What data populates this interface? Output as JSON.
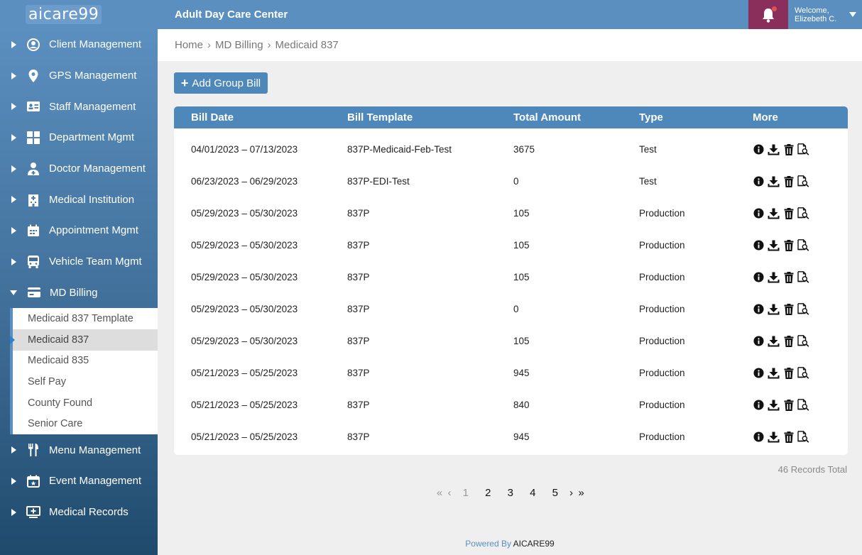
{
  "header": {
    "logo_text": "aicare99",
    "title": "Adult Day Care Center",
    "welcome": "Welcome,",
    "user_name": "Elizebeth C."
  },
  "sidebar": {
    "items": [
      {
        "label": "Client Management",
        "icon": "user-circle-icon"
      },
      {
        "label": "GPS Management",
        "icon": "location-pin-icon"
      },
      {
        "label": "Staff Management",
        "icon": "id-card-icon"
      },
      {
        "label": "Department Mgmt",
        "icon": "grid-icon"
      },
      {
        "label": "Doctor Management",
        "icon": "doctor-icon"
      },
      {
        "label": "Medical Institution",
        "icon": "hospital-icon"
      },
      {
        "label": "Appointment Mgmt",
        "icon": "calendar-icon"
      },
      {
        "label": "Vehicle Team Mgmt",
        "icon": "bus-icon"
      },
      {
        "label": "MD Billing",
        "icon": "credit-card-icon"
      },
      {
        "label": "Menu Management",
        "icon": "fork-knife-icon"
      },
      {
        "label": "Event Management",
        "icon": "calendar-star-icon"
      },
      {
        "label": "Medical Records",
        "icon": "medical-monitor-icon"
      }
    ],
    "submenu": [
      "Medicaid 837 Template",
      "Medicaid 837",
      "Medicaid 835",
      "Self Pay",
      "County Found",
      "Senior Care"
    ]
  },
  "breadcrumb": [
    "Home",
    "MD Billing",
    "Medicaid 837"
  ],
  "add_button": "Add Group Bill",
  "table": {
    "columns": [
      "Bill Date",
      "Bill Template",
      "Total Amount",
      "Type",
      "More"
    ],
    "rows": [
      [
        "04/01/2023 – 07/13/2023",
        "837P-Medicaid-Feb-Test",
        "3675",
        "Test"
      ],
      [
        "06/23/2023 – 06/29/2023",
        "837P-EDI-Test",
        "0",
        "Test"
      ],
      [
        "05/29/2023 – 05/30/2023",
        "837P",
        "105",
        "Production"
      ],
      [
        "05/29/2023 – 05/30/2023",
        "837P",
        "105",
        "Production"
      ],
      [
        "05/29/2023 – 05/30/2023",
        "837P",
        "105",
        "Production"
      ],
      [
        "05/29/2023 – 05/30/2023",
        "837P",
        "0",
        "Production"
      ],
      [
        "05/29/2023 – 05/30/2023",
        "837P",
        "105",
        "Production"
      ],
      [
        "05/21/2023 – 05/25/2023",
        "837P",
        "945",
        "Production"
      ],
      [
        "05/21/2023 – 05/25/2023",
        "837P",
        "840",
        "Production"
      ],
      [
        "05/21/2023 – 05/25/2023",
        "837P",
        "945",
        "Production"
      ]
    ]
  },
  "records_total": "46 Records Total",
  "pagination": {
    "pages": [
      "1",
      "2",
      "3",
      "4",
      "5"
    ],
    "current": "1"
  },
  "footer": {
    "prefix": "Powered By",
    "brand": "AICARE99"
  },
  "colors": {
    "primary": "#4e87ba",
    "header": "#5a8fbf",
    "notification": "#8a2e5b"
  }
}
